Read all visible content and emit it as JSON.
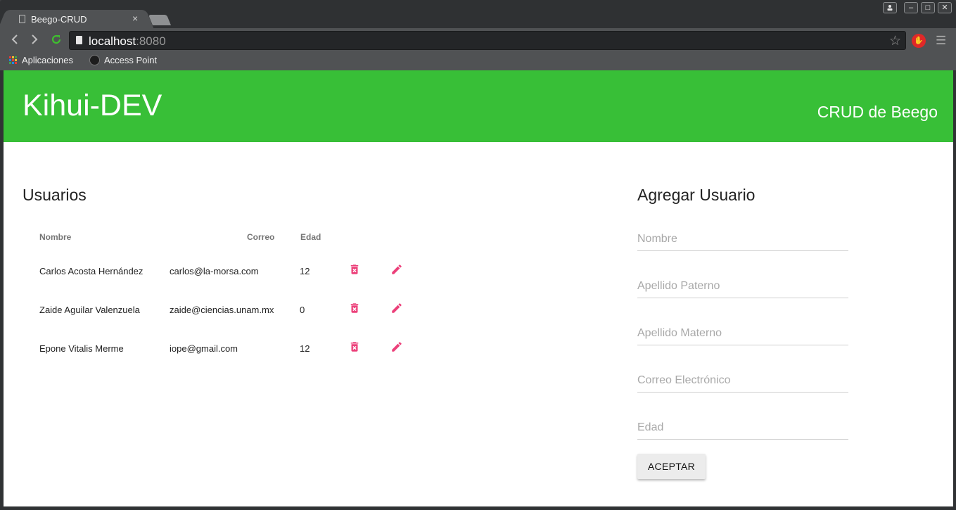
{
  "browser": {
    "tab_title": "Beego-CRUD",
    "tab_close": "×",
    "url_host": "localhost",
    "url_port": ":8080",
    "bookmarks": [
      "Aplicaciones",
      "Access Point"
    ],
    "win_buttons": [
      "–",
      "□",
      "✕"
    ]
  },
  "header": {
    "brand": "Kihui-DEV",
    "nav_link": "CRUD de Beego"
  },
  "users": {
    "title": "Usuarios",
    "columns": [
      "Nombre",
      "Correo",
      "Edad"
    ],
    "rows": [
      {
        "nombre": "Carlos Acosta Hernández",
        "correo": "carlos@la-morsa.com",
        "edad": "12"
      },
      {
        "nombre": "Zaide Aguilar Valenzuela",
        "correo": "zaide@ciencias.unam.mx",
        "edad": "0"
      },
      {
        "nombre": "Epone Vitalis Merme",
        "correo": "iope@gmail.com",
        "edad": "12"
      }
    ]
  },
  "form": {
    "title": "Agregar Usuario",
    "fields": [
      {
        "placeholder": "Nombre",
        "value": ""
      },
      {
        "placeholder": "Apellido Paterno",
        "value": ""
      },
      {
        "placeholder": "Apellido Materno",
        "value": ""
      },
      {
        "placeholder": "Correo Electrónico",
        "value": ""
      },
      {
        "placeholder": "Edad",
        "value": ""
      }
    ],
    "submit_label": "ACEPTAR"
  },
  "colors": {
    "header_green": "#38bf37",
    "action_pink": "#ec407a"
  },
  "icons": {
    "delete": "delete-forever-icon",
    "edit": "pencil-icon"
  }
}
